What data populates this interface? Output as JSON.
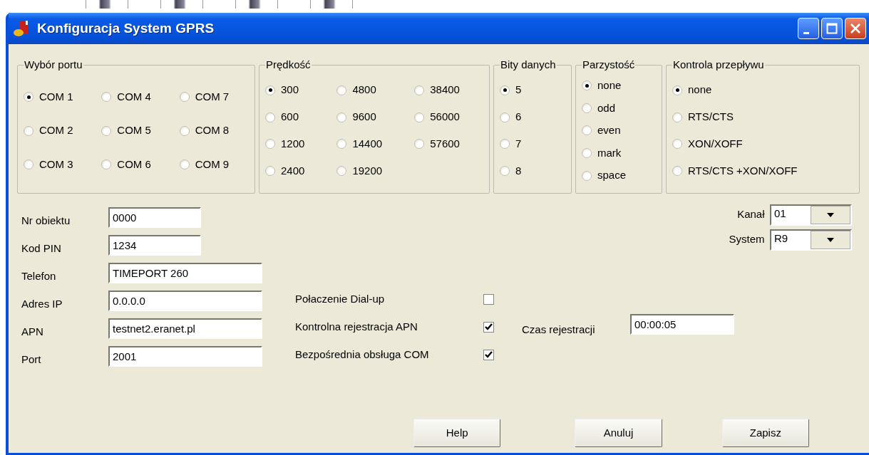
{
  "window": {
    "title": "Konfiguracja System GPRS"
  },
  "groups": [
    {
      "title": "Wybór portu",
      "options": [
        {
          "label": "COM 1",
          "selected": true
        },
        {
          "label": "COM 4",
          "selected": false
        },
        {
          "label": "COM 7",
          "selected": false
        },
        {
          "label": "COM 2",
          "selected": false
        },
        {
          "label": "COM 5",
          "selected": false
        },
        {
          "label": "COM 8",
          "selected": false
        },
        {
          "label": "COM 3",
          "selected": false
        },
        {
          "label": "COM 6",
          "selected": false
        },
        {
          "label": "COM 9",
          "selected": false
        }
      ]
    },
    {
      "title": "Prędkość",
      "options": [
        {
          "label": "300",
          "selected": true
        },
        {
          "label": "4800",
          "selected": false
        },
        {
          "label": "38400",
          "selected": false
        },
        {
          "label": "600",
          "selected": false
        },
        {
          "label": "9600",
          "selected": false
        },
        {
          "label": "56000",
          "selected": false
        },
        {
          "label": "1200",
          "selected": false
        },
        {
          "label": "14400",
          "selected": false
        },
        {
          "label": "57600",
          "selected": false
        },
        {
          "label": "2400",
          "selected": false
        },
        {
          "label": "19200",
          "selected": false
        }
      ]
    },
    {
      "title": "Bity danych",
      "options": [
        {
          "label": "5",
          "selected": true
        },
        {
          "label": "6",
          "selected": false
        },
        {
          "label": "7",
          "selected": false
        },
        {
          "label": "8",
          "selected": false
        }
      ]
    },
    {
      "title": "Parzystość",
      "options": [
        {
          "label": "none",
          "selected": true
        },
        {
          "label": "odd",
          "selected": false
        },
        {
          "label": "even",
          "selected": false
        },
        {
          "label": "mark",
          "selected": false
        },
        {
          "label": "space",
          "selected": false
        }
      ]
    },
    {
      "title": "Kontrola przepływu",
      "options": [
        {
          "label": "none",
          "selected": true
        },
        {
          "label": "RTS/CTS",
          "selected": false
        },
        {
          "label": "XON/XOFF",
          "selected": false
        },
        {
          "label": "RTS/CTS +XON/XOFF",
          "selected": false
        }
      ]
    }
  ],
  "fields": [
    {
      "label": "Nr obiektu",
      "value": "0000"
    },
    {
      "label": "Kod PIN",
      "value": "1234"
    },
    {
      "label": "Telefon",
      "value": "TIMEPORT 260"
    },
    {
      "label": "Adres IP",
      "value": "0.0.0.0"
    },
    {
      "label": "APN",
      "value": "testnet2.eranet.pl"
    },
    {
      "label": "Port",
      "value": "2001"
    }
  ],
  "options": [
    {
      "label": "Połaczenie Dial-up",
      "checked": false
    },
    {
      "label": "Kontrolna rejestracja APN",
      "checked": true
    },
    {
      "label": "Bezpośrednia obsługa COM",
      "checked": true
    }
  ],
  "registration_time": {
    "label": "Czas rejestracji",
    "value": "00:00:05"
  },
  "combos": [
    {
      "label": "Kanał",
      "value": "01"
    },
    {
      "label": "System",
      "value": "R9"
    }
  ],
  "buttons": [
    "Help",
    "Anuluj",
    "Zapisz"
  ]
}
